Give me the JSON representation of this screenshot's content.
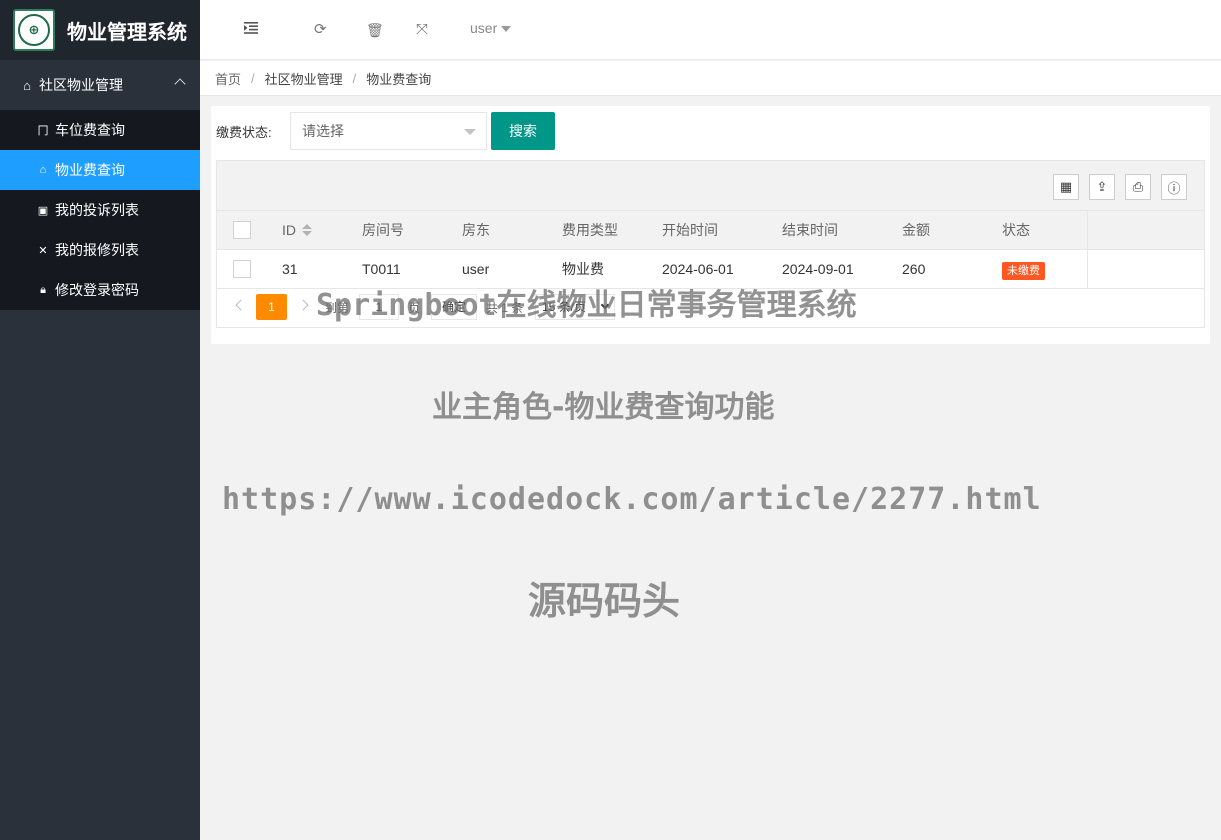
{
  "app": {
    "title": "物业管理系统"
  },
  "sidebar": {
    "group": {
      "label": "社区物业管理"
    },
    "items": [
      {
        "label": "车位费查询",
        "icon": "parking-icon",
        "active": false
      },
      {
        "label": "物业费查询",
        "icon": "home-icon",
        "active": true
      },
      {
        "label": "我的投诉列表",
        "icon": "complaint-icon",
        "active": false
      },
      {
        "label": "我的报修列表",
        "icon": "tools-icon",
        "active": false
      },
      {
        "label": "修改登录密码",
        "icon": "lock-icon",
        "active": false
      }
    ]
  },
  "header": {
    "user": "user",
    "icons": [
      "menu-collapse-icon",
      "refresh-icon",
      "trash-icon",
      "fullscreen-icon"
    ]
  },
  "breadcrumb": [
    "首页",
    "社区物业管理",
    "物业费查询"
  ],
  "filter": {
    "label": "缴费状态:",
    "placeholder": "请选择",
    "search_label": "搜索"
  },
  "table": {
    "toolbar_icons": [
      "columns-icon",
      "export-icon",
      "print-icon",
      "info-icon"
    ],
    "columns": [
      "ID",
      "房间号",
      "房东",
      "费用类型",
      "开始时间",
      "结束时间",
      "金额",
      "状态"
    ],
    "rows": [
      {
        "id": "31",
        "room": "T0011",
        "owner": "user",
        "type": "物业费",
        "start": "2024-06-01",
        "end": "2024-09-01",
        "amount": "260",
        "status": "未缴费"
      }
    ],
    "status_color": "#ff5722"
  },
  "pager": {
    "current": "1",
    "goto_label": "到第",
    "page_value": "1",
    "page_unit": "页",
    "confirm": "确定",
    "total": "共 1 条",
    "page_size": "15 条/页"
  },
  "watermarks": [
    "Springboot在线物业日常事务管理系统",
    "业主角色-物业费查询功能",
    "https://www.icodedock.com/article/2277.html",
    "源码码头"
  ],
  "colors": {
    "accent": "#1e9fff",
    "search_button": "#009688",
    "pager_current": "#ff8a00",
    "sidebar": "#2a313b"
  }
}
